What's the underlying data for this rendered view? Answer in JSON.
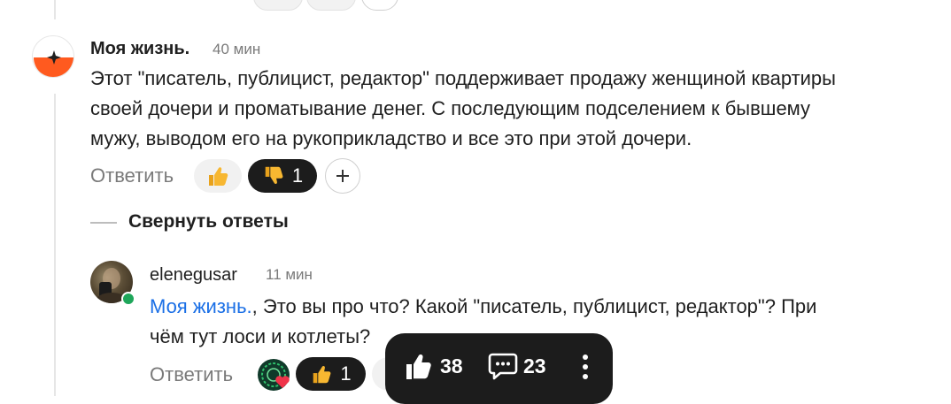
{
  "comment_1": {
    "author": "Моя жизнь.",
    "time": "40 мин",
    "text": "Этот \"писатель, публицист, редактор\" поддерживает продажу женщиной квартиры своей дочери и проматывание денег. С последующим подселением к бывшему мужу, выводом его на рукоприкладство и все это при этой дочери.",
    "text_lines": [
      "Этот \"писатель, публицист, редактор\" поддерживает продажу женщиной квартиры",
      "своей дочери и проматывание денег. С последующим подселением к бывшему",
      "мужу, выводом его на рукоприкладство и все это при этой дочери."
    ],
    "reply_label": "Ответить",
    "dislike_count": "1"
  },
  "collapse_label": "Свернуть ответы",
  "comment_2": {
    "author": "elenegusar",
    "time": "11 мин",
    "mention": "Моя жизнь.",
    "text_after_mention": ", Это вы про что? Какой \"писатель, публицист, редактор\"? При",
    "text_line2": "чём тут лоси и котлеты?",
    "reply_label": "Ответить",
    "like_count": "1"
  },
  "floating_bar": {
    "likes": "38",
    "comments": "23"
  },
  "icons": {
    "like": "thumbs-up-icon",
    "dislike": "thumbs-down-icon",
    "add_reaction": "plus-icon",
    "comments": "speech-bubble-icon",
    "more": "more-vertical-icon"
  },
  "colors": {
    "mention": "#1a6fe6",
    "dark_pill": "#1c1c1c",
    "avatar_orange": "#ff5a1f",
    "online": "#1ea65a"
  }
}
